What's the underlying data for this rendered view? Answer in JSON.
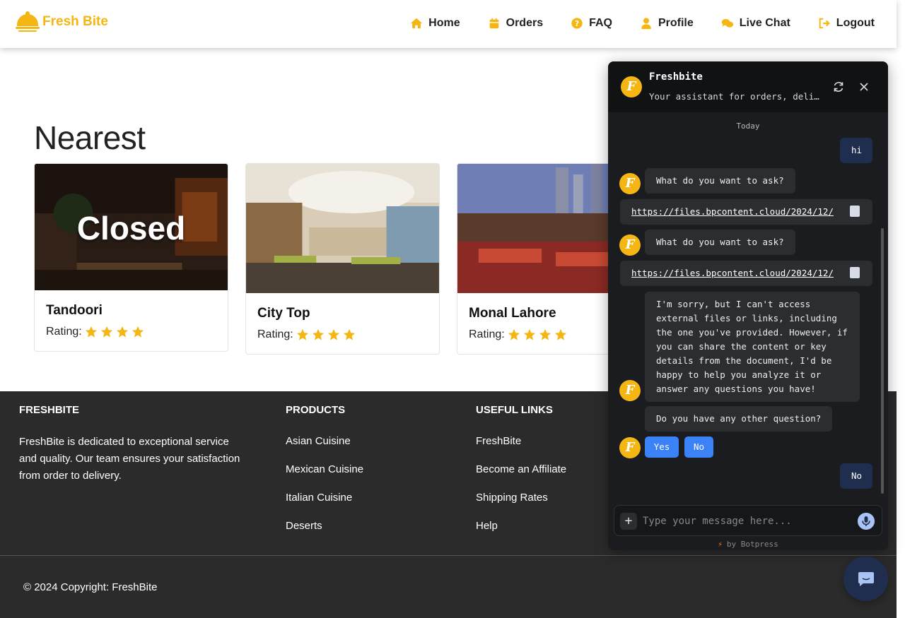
{
  "brand": {
    "name": "Fresh Bite",
    "color": "#f5b614"
  },
  "nav": [
    {
      "label": "Home",
      "icon": "home-icon"
    },
    {
      "label": "Orders",
      "icon": "calendar-icon"
    },
    {
      "label": "FAQ",
      "icon": "question-circle-icon"
    },
    {
      "label": "Profile",
      "icon": "user-icon"
    },
    {
      "label": "Live Chat",
      "icon": "chat-bubbles-icon"
    },
    {
      "label": "Logout",
      "icon": "logout-icon"
    }
  ],
  "section_title": "Nearest",
  "restaurants": [
    {
      "name": "Tandoori",
      "rating_label": "Rating:",
      "stars": 4,
      "closed": true,
      "closed_label": "Closed"
    },
    {
      "name": "City Top",
      "rating_label": "Rating:",
      "stars": 4,
      "closed": false
    },
    {
      "name": "Monal Lahore",
      "rating_label": "Rating:",
      "stars": 4,
      "closed": false
    }
  ],
  "footer": {
    "about_title": "FRESHBITE",
    "about_text": "FreshBite is dedicated to exceptional service and quality. Our team ensures your satisfaction from order to delivery.",
    "products_title": "PRODUCTS",
    "products": [
      "Asian Cuisine",
      "Mexican Cuisine",
      "Italian Cuisine",
      "Deserts"
    ],
    "links_title": "USEFUL LINKS",
    "links": [
      "FreshBite",
      "Become an Affiliate",
      "Shipping Rates",
      "Help"
    ],
    "copyright": "© 2024 Copyright: FreshBite"
  },
  "chat": {
    "title": "Freshbite",
    "subtitle": "Your assistant for orders, delivery and more",
    "date_label": "Today",
    "avatar_letter": "F",
    "messages": {
      "user_hi": "hi",
      "bot_ask_1": "What do you want to ask?",
      "link_1": "https://files.bpcontent.cloud/2024/12/",
      "bot_ask_2": "What do you want to ask?",
      "link_2": "https://files.bpcontent.cloud/2024/12/",
      "bot_sorry": "I'm sorry, but I can't access external files or links, including the one you've provided. However, if you can share the content or key details from the document, I'd be happy to help you analyze it or answer any questions you have!",
      "bot_other": "Do you have any other question?",
      "user_no": "No"
    },
    "quick_replies": [
      "Yes",
      "No"
    ],
    "input_placeholder": "Type your message here...",
    "powered_by": "by Botpress",
    "accent": "#3b82f6"
  }
}
